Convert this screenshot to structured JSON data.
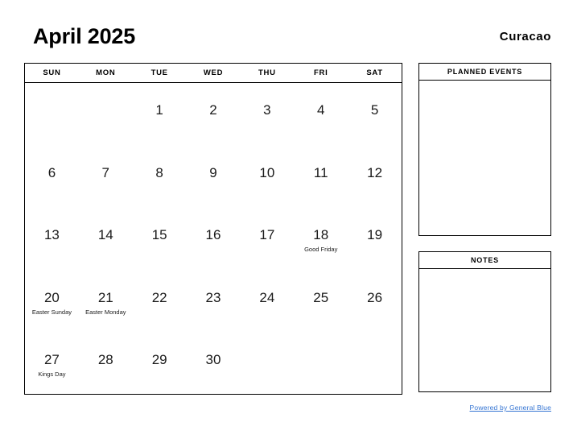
{
  "header": {
    "title": "April 2025",
    "locality": "Curacao"
  },
  "calendar": {
    "weekdays": [
      "SUN",
      "MON",
      "TUE",
      "WED",
      "THU",
      "FRI",
      "SAT"
    ],
    "weeks": [
      [
        {
          "day": "",
          "event": ""
        },
        {
          "day": "",
          "event": ""
        },
        {
          "day": "1",
          "event": ""
        },
        {
          "day": "2",
          "event": ""
        },
        {
          "day": "3",
          "event": ""
        },
        {
          "day": "4",
          "event": ""
        },
        {
          "day": "5",
          "event": ""
        }
      ],
      [
        {
          "day": "6",
          "event": ""
        },
        {
          "day": "7",
          "event": ""
        },
        {
          "day": "8",
          "event": ""
        },
        {
          "day": "9",
          "event": ""
        },
        {
          "day": "10",
          "event": ""
        },
        {
          "day": "11",
          "event": ""
        },
        {
          "day": "12",
          "event": ""
        }
      ],
      [
        {
          "day": "13",
          "event": ""
        },
        {
          "day": "14",
          "event": ""
        },
        {
          "day": "15",
          "event": ""
        },
        {
          "day": "16",
          "event": ""
        },
        {
          "day": "17",
          "event": ""
        },
        {
          "day": "18",
          "event": "Good Friday"
        },
        {
          "day": "19",
          "event": ""
        }
      ],
      [
        {
          "day": "20",
          "event": "Easter Sunday"
        },
        {
          "day": "21",
          "event": "Easter Monday"
        },
        {
          "day": "22",
          "event": ""
        },
        {
          "day": "23",
          "event": ""
        },
        {
          "day": "24",
          "event": ""
        },
        {
          "day": "25",
          "event": ""
        },
        {
          "day": "26",
          "event": ""
        }
      ],
      [
        {
          "day": "27",
          "event": "Kings Day"
        },
        {
          "day": "28",
          "event": ""
        },
        {
          "day": "29",
          "event": ""
        },
        {
          "day": "30",
          "event": ""
        },
        {
          "day": "",
          "event": ""
        },
        {
          "day": "",
          "event": ""
        },
        {
          "day": "",
          "event": ""
        }
      ]
    ]
  },
  "panels": [
    {
      "id": "planned-events",
      "title": "PLANNED EVENTS",
      "content": ""
    },
    {
      "id": "notes",
      "title": "NOTES",
      "content": ""
    }
  ],
  "footer": {
    "link_text": "Powered by General Blue",
    "link_color": "#3575d3"
  }
}
